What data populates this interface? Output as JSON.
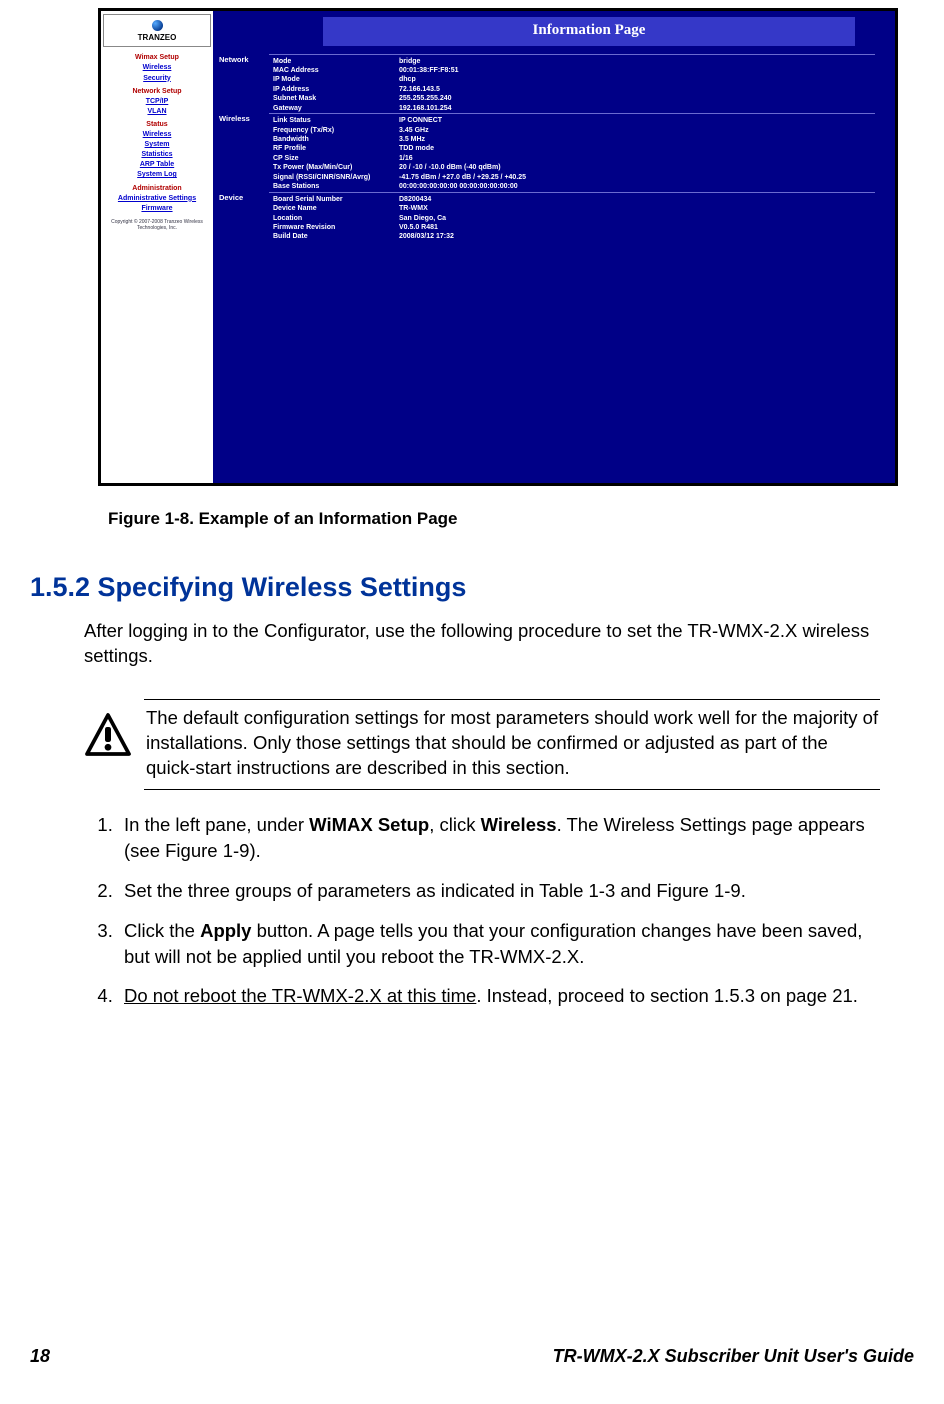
{
  "screenshot": {
    "logo_text": "TRANZEO",
    "info_title": "Information Page",
    "nav": {
      "wimax_setup": "Wimax Setup",
      "wireless": "Wireless",
      "security": "Security",
      "network_setup": "Network Setup",
      "tcpip": "TCP/IP",
      "vlan": "VLAN",
      "status": "Status",
      "wireless2": "Wireless",
      "system": "System",
      "statistics": "Statistics",
      "arp_table": "ARP Table",
      "system_log": "System Log",
      "administration": "Administration",
      "admin_settings": "Administrative Settings",
      "firmware": "Firmware",
      "copyright": "Copyright © 2007-2008 Tranzeo Wireless Technologies, Inc."
    },
    "sections": {
      "network": {
        "label": "Network",
        "mode_k": "Mode",
        "mode_v": "bridge",
        "mac_k": "MAC Address",
        "mac_v": "00:01:38:FF:F8:51",
        "ipmode_k": "IP Mode",
        "ipmode_v": "dhcp",
        "ipaddr_k": "IP Address",
        "ipaddr_v": "72.166.143.5",
        "subnet_k": "Subnet Mask",
        "subnet_v": "255.255.255.240",
        "gateway_k": "Gateway",
        "gateway_v": "192.168.101.254"
      },
      "wireless": {
        "label": "Wireless",
        "link_k": "Link Status",
        "link_v": "IP CONNECT",
        "freq_k": "Frequency (Tx/Rx)",
        "freq_v": "3.45 GHz",
        "bw_k": "Bandwidth",
        "bw_v": "3.5 MHz",
        "rf_k": "RF Profile",
        "rf_v": "TDD mode",
        "cp_k": "CP Size",
        "cp_v": "1/16",
        "txp_k": "Tx Power (Max/Min/Cur)",
        "txp_v": "20 / -10 / -10.0 dBm (-40 qdBm)",
        "sig_k": "Signal (RSSI/CINR/SNR/Avrg)",
        "sig_v": "-41.75 dBm / +27.0 dB / +29.25 / +40.25",
        "base_k": "Base Stations",
        "base_v": "00:00:00:00:00:00 00:00:00:00:00:00"
      },
      "device": {
        "label": "Device",
        "serial_k": "Board Serial Number",
        "serial_v": "D8200434",
        "dname_k": "Device Name",
        "dname_v": "TR-WMX",
        "loc_k": "Location",
        "loc_v": "San Diego, Ca",
        "fw_k": "Firmware Revision",
        "fw_v": "V0.5.0 R481",
        "build_k": "Build Date",
        "build_v": "2008/03/12 17:32"
      }
    }
  },
  "figure_caption": "Figure 1-8. Example of an Information Page",
  "heading": "1.5.2 Specifying Wireless Settings",
  "intro": "After logging in to the Configurator, use the following procedure to set the TR-WMX-2.X wireless settings.",
  "note": "The default configuration settings for most parameters should work well for the majority of installations. Only those settings that should be confirmed or adjusted as part of the quick-start instructions are described in this section.",
  "steps": {
    "s1a": "In the left pane, under ",
    "s1b": "WiMAX Setup",
    "s1c": ", click ",
    "s1d": "Wireless",
    "s1e": ". The Wireless Settings page appears (see Figure 1-9).",
    "s2": "Set the three groups of parameters as indicated in Table 1-3 and Figure 1-9.",
    "s3a": "Click the ",
    "s3b": "Apply",
    "s3c": " button. A page tells you that your configuration changes have been saved, but will not be applied until you reboot the TR-WMX-2.X.",
    "s4a": "Do not reboot the TR-WMX-2.X at this time",
    "s4b": ". Instead, proceed to section 1.5.3 on page 21."
  },
  "footer": {
    "page": "18",
    "doc": "TR-WMX-2.X Subscriber Unit User's Guide"
  }
}
